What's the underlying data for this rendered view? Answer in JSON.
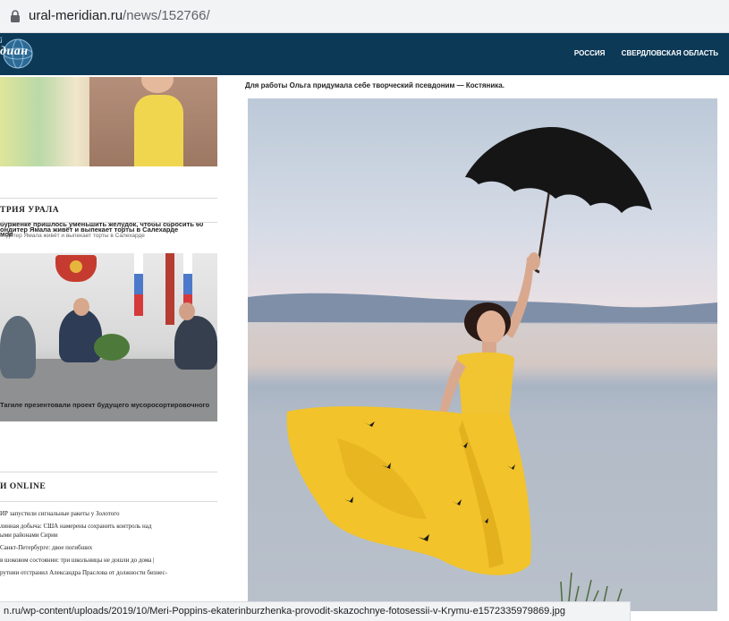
{
  "browser": {
    "url_host": "ural-meridian.ru",
    "url_path": "/news/152766/",
    "status_url": "n.ru/wp-content/uploads/2019/10/Meri-Poppins-ekaterinburzhenka-provodit-skazochnye-fotosessii-v-Krymu-e1572335979869.jpg"
  },
  "header": {
    "logo_prefix": "й",
    "logo_text": "диан",
    "nav": [
      "РОССИЯ",
      "СВЕРДЛОВСКАЯ ОБЛАСТЬ"
    ],
    "background": "#0c3956"
  },
  "sidebar": {
    "story1_caption": "бурженке пришлось уменьшить желудок, чтобы сбросить 60\nмов",
    "section_history": "ТРИЯ УРАЛА",
    "history_title": "ондитер Ямала живёт и выпекает торты в Салехарде",
    "history_sub": "ондитер Ямала живёт и выпекает торты в Салехарде",
    "story2_caption": "Тагиле презентовали проект будущего мусоросортировочного",
    "section_online": "И ONLINE",
    "online_items": [
      "ИР запустили сигнальные ракеты у Золотого",
      "линная добыча: США намерены сохранить контроль над\nыми районами Сирии",
      "Санкт-Петербурге: двое погибших",
      "в шоковом состоянии: три школьницы не дошли до дома |",
      "рутнии отстранил Александра Праслова от должности бизнес-"
    ]
  },
  "article": {
    "photo_caption": "Для работы Ольга придумала себе творческий псевдоним — Костяника."
  }
}
